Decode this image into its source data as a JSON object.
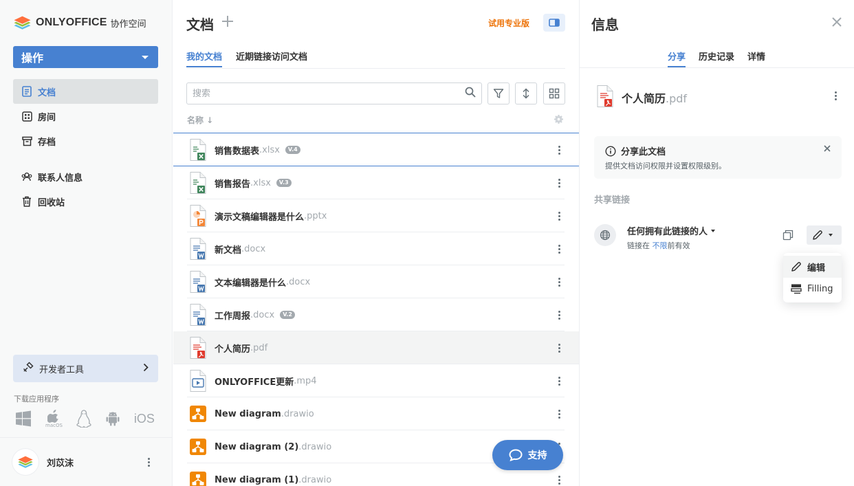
{
  "brand": {
    "name": "ONLYOFFICE",
    "subtitle": "协作空间"
  },
  "sidebar": {
    "actions_label": "操作",
    "items": [
      {
        "label": "文档",
        "icon": "document-icon",
        "active": true
      },
      {
        "label": "房间",
        "icon": "rooms-icon"
      },
      {
        "label": "存档",
        "icon": "archive-icon"
      },
      {
        "label": "联系人信息",
        "icon": "contacts-icon"
      },
      {
        "label": "回收站",
        "icon": "trash-icon"
      }
    ],
    "dev_tools_label": "开发者工具",
    "download_label": "下载应用程序",
    "apps": [
      "windows-icon",
      "macos-icon",
      "linux-icon",
      "android-icon",
      "ios-icon"
    ],
    "macos_label": "macOS",
    "ios_label": "iOS",
    "user_name": "刘苡沫"
  },
  "main": {
    "title": "文档",
    "trial_label": "试用专业版",
    "tabs": [
      {
        "label": "我的文档",
        "active": true
      },
      {
        "label": "近期链接访问文档"
      }
    ],
    "search_placeholder": "搜索",
    "column_name": "名称 ↓",
    "files": [
      {
        "name": "销售数据表",
        "ext": ".xlsx",
        "type": "xlsx",
        "version": "V.4"
      },
      {
        "name": "销售报告",
        "ext": ".xlsx",
        "type": "xlsx",
        "version": "V.3"
      },
      {
        "name": "演示文稿编辑器是什么",
        "ext": ".pptx",
        "type": "pptx"
      },
      {
        "name": "新文档",
        "ext": ".docx",
        "type": "docx"
      },
      {
        "name": "文本编辑器是什么",
        "ext": ".docx",
        "type": "docx"
      },
      {
        "name": "工作周报",
        "ext": ".docx",
        "type": "docx",
        "version": "V.2"
      },
      {
        "name": "个人简历",
        "ext": ".pdf",
        "type": "pdf",
        "selected": true
      },
      {
        "name": "ONLYOFFICE更新",
        "ext": ".mp4",
        "type": "mp4"
      },
      {
        "name": "New diagram",
        "ext": ".drawio",
        "type": "drawio"
      },
      {
        "name": "New diagram (2)",
        "ext": ".drawio",
        "type": "drawio"
      },
      {
        "name": "New diagram (1)",
        "ext": ".drawio",
        "type": "drawio"
      }
    ],
    "support_label": "支持"
  },
  "info": {
    "title": "信息",
    "tabs": [
      {
        "label": "分享",
        "active": true
      },
      {
        "label": "历史记录"
      },
      {
        "label": "详情"
      }
    ],
    "file_name": "个人简历",
    "file_ext": ".pdf",
    "notice_title": "分享此文档",
    "notice_desc": "提供文档访问权限并设置权限级别。",
    "share_section": "共享链接",
    "link_who": "任何拥有此链接的人",
    "link_valid_prefix": "链接在 ",
    "link_valid_hl": "不限",
    "link_valid_suffix": "前有效",
    "perm_options": [
      {
        "label": "编辑",
        "icon": "pencil-icon",
        "active": true
      },
      {
        "label": "Filling",
        "icon": "form-filling-icon"
      }
    ]
  },
  "colors": {
    "accent": "#4781d1",
    "trial": "#ed7309",
    "xlsx": "#40865c",
    "docx": "#4778b0",
    "pptx": "#f48636",
    "pdf": "#e03b2e",
    "drawio": "#f08705"
  }
}
